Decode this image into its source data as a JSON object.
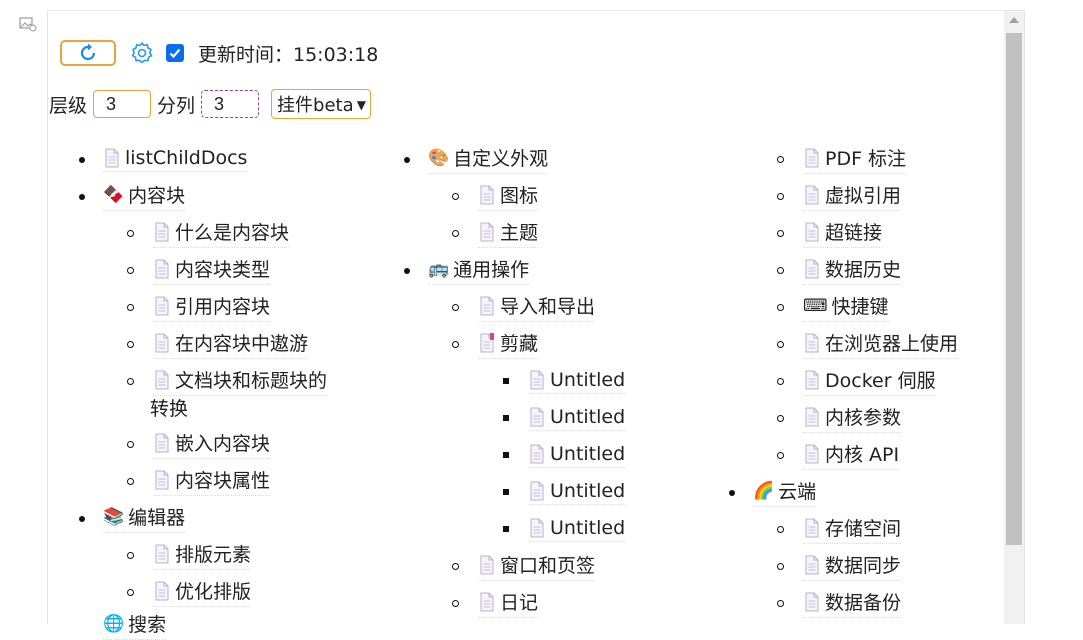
{
  "toolbar": {
    "update_label": "更新时间：15:03:18",
    "level_label": "层级",
    "level_value": "3",
    "columns_label": "分列",
    "columns_value": "3",
    "select_value": "挂件beta"
  },
  "icons": {
    "doc": "document-icon",
    "refresh": "refresh-icon",
    "settings": "gear-icon"
  },
  "colors": {
    "accent_orange": "#e8a33a",
    "accent_blue": "#0b6cf0",
    "dashed_purple": "#9c3d8f"
  },
  "tree": {
    "col1": [
      {
        "label": "listChildDocs",
        "icon": "document-icon"
      },
      {
        "label": "内容块",
        "icon": "chocolate-emoji"
      },
      {
        "label": "什么是内容块",
        "icon": "document-icon"
      },
      {
        "label": "内容块类型",
        "icon": "document-icon"
      },
      {
        "label": "引用内容块",
        "icon": "document-icon"
      },
      {
        "label": "在内容块中遨游",
        "icon": "document-icon"
      },
      {
        "label": "文档块和标题块的",
        "icon": "document-icon"
      },
      {
        "label": "转换"
      },
      {
        "label": "嵌入内容块",
        "icon": "document-icon"
      },
      {
        "label": "内容块属性",
        "icon": "document-icon"
      },
      {
        "label": "编辑器",
        "icon": "books-emoji"
      },
      {
        "label": "排版元素",
        "icon": "document-icon"
      },
      {
        "label": "优化排版",
        "icon": "document-icon"
      },
      {
        "label": "搜索",
        "icon": "globe-emoji"
      }
    ],
    "col2": [
      {
        "label": "自定义外观",
        "icon": "palette-emoji"
      },
      {
        "label": "图标",
        "icon": "document-icon"
      },
      {
        "label": "主题",
        "icon": "document-icon"
      },
      {
        "label": "通用操作",
        "icon": "bus-emoji"
      },
      {
        "label": "导入和导出",
        "icon": "document-icon"
      },
      {
        "label": "剪藏",
        "icon": "bookmark-doc-icon"
      },
      {
        "label": "Untitled",
        "icon": "document-icon"
      },
      {
        "label": "Untitled",
        "icon": "document-icon"
      },
      {
        "label": "Untitled",
        "icon": "document-icon"
      },
      {
        "label": "Untitled",
        "icon": "document-icon"
      },
      {
        "label": "Untitled",
        "icon": "document-icon"
      },
      {
        "label": "窗口和页签",
        "icon": "document-icon"
      },
      {
        "label": "日记",
        "icon": "document-icon"
      }
    ],
    "col3": [
      {
        "label": "PDF 标注",
        "icon": "document-icon"
      },
      {
        "label": "虚拟引用",
        "icon": "document-icon"
      },
      {
        "label": "超链接",
        "icon": "document-icon"
      },
      {
        "label": "数据历史",
        "icon": "document-icon"
      },
      {
        "label": "快捷键",
        "icon": "keyboard-emoji"
      },
      {
        "label": "在浏览器上使用",
        "icon": "document-icon"
      },
      {
        "label": "Docker 伺服",
        "icon": "document-icon"
      },
      {
        "label": "内核参数",
        "icon": "document-icon"
      },
      {
        "label": "内核 API",
        "icon": "document-icon"
      },
      {
        "label": "云端",
        "icon": "rainbow-emoji"
      },
      {
        "label": "存储空间",
        "icon": "document-icon"
      },
      {
        "label": "数据同步",
        "icon": "document-icon"
      },
      {
        "label": "数据备份",
        "icon": "document-icon"
      }
    ]
  }
}
